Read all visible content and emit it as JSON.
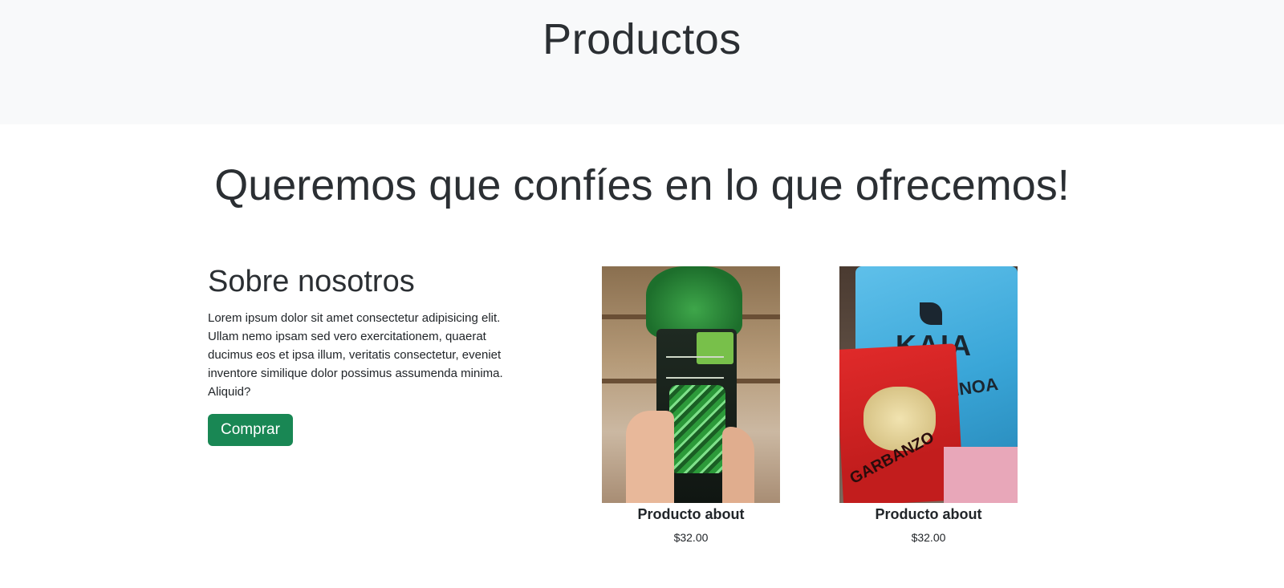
{
  "hero": {
    "title": "Productos"
  },
  "tagline": "Queremos que confíes en lo que ofrecemos!",
  "about": {
    "title": "Sobre nosotros",
    "text": "Lorem ipsum dolor sit amet consectetur adipisicing elit. Ullam nemo ipsam sed vero exercitationem, quaerat ducimus eos et ipsa illum, veritatis consectetur, eveniet inventore similique dolor possimus assumenda minima. Aliquid?",
    "button_label": "Comprar"
  },
  "products": [
    {
      "name": "Producto about",
      "price": "$32.00",
      "image": "product-photo-chocolate"
    },
    {
      "name": "Producto about",
      "price": "$32.00",
      "image": "product-photo-kaia-snacks"
    }
  ],
  "colors": {
    "hero_bg": "#f8f9fa",
    "button_bg": "#198754",
    "button_text": "#ffffff",
    "text": "#212529"
  }
}
